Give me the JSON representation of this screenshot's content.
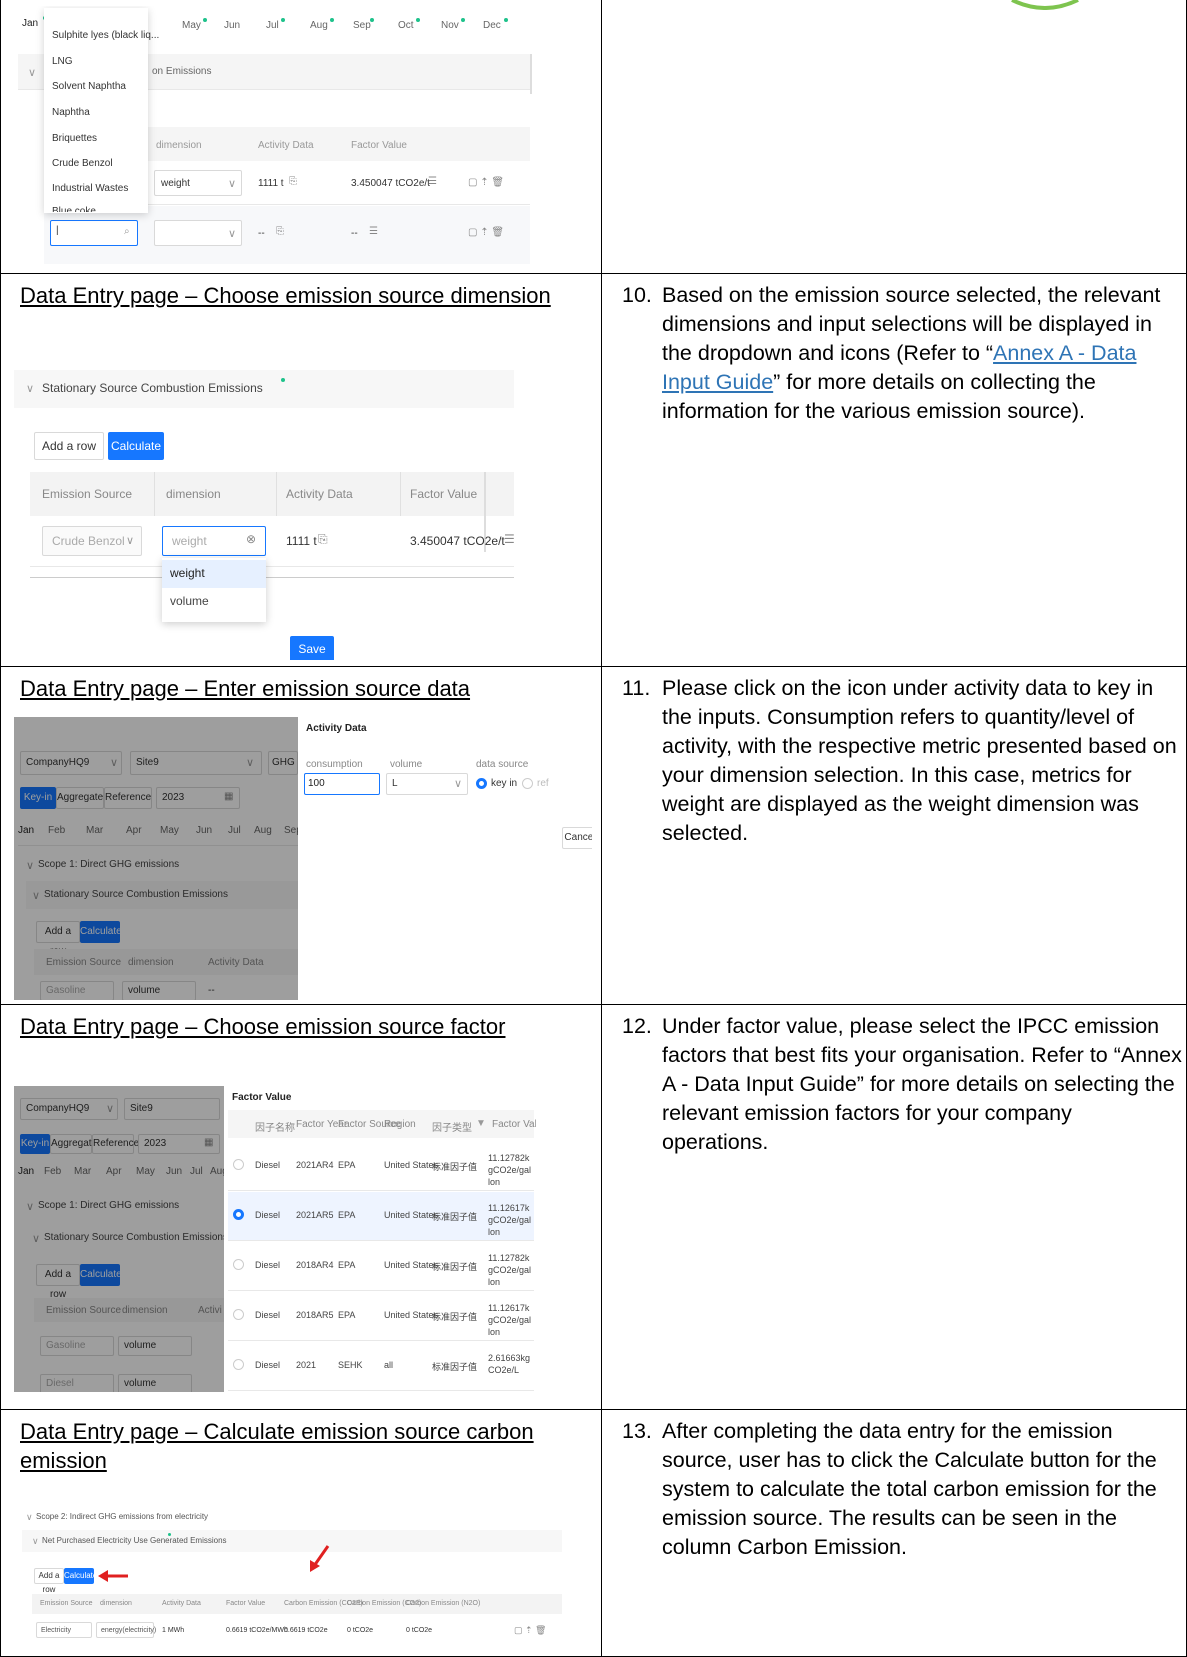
{
  "rows": [
    {
      "caption": "",
      "step_number": "",
      "step_text": ""
    },
    {
      "caption": "Data Entry page – Choose emission source dimension",
      "step_number": "10.",
      "step_text_before": "Based on the emission source selected, the relevant dimensions and input selections will be displayed in the dropdown and icons (Refer to “",
      "step_link": "Annex A - Data Input Guide",
      "step_text_after": "” for more details on collecting the information for the various emission source)."
    },
    {
      "caption": "Data Entry page – Enter emission source data",
      "step_number": "11.",
      "step_text": "Please click on the icon under activity data to key in the inputs. Consumption refers to quantity/level of activity, with the respective metric presented based on your dimension selection. In this case, metrics for weight are displayed as the weight dimension was selected."
    },
    {
      "caption": "Data Entry page – Choose emission source factor",
      "step_number": "12.",
      "step_text": "Under factor value, please select the IPCC emission factors that best fits your organisation.  Refer to “Annex A - Data Input Guide” for more details on selecting the relevant emission factors for your company operations."
    },
    {
      "caption": "Data Entry page – Calculate emission source carbon emission",
      "step_number": "13.",
      "step_text": "After completing the data entry for the emission source, user has to click the Calculate button for the system to calculate the total carbon emission for the emission source. The results can be seen in the column Carbon Emission."
    }
  ],
  "shot1": {
    "months": [
      "Jan",
      "May",
      "Jun",
      "Jul",
      "Aug",
      "Sep",
      "Oct",
      "Nov",
      "Dec"
    ],
    "dropdown_items": [
      "Sulphite lyes (black liq...",
      "LNG",
      "Solvent Naphtha",
      "Naphtha",
      "Briquettes",
      "Crude Benzol",
      "Industrial Wastes",
      "Blue coke"
    ],
    "section_title": "on Emissions",
    "col_dimension": "dimension",
    "col_activity": "Activity Data",
    "col_factor": "Factor Value",
    "row1_dimension": "weight",
    "row1_activity": "1111 t",
    "row1_factor": "3.450047 tCO2e/t",
    "row2_activity": "--",
    "row2_factor": "--",
    "search_placeholder": ""
  },
  "shot2": {
    "section_title": "Stationary Source Combustion Emissions",
    "add_row": "Add a row",
    "calculate": "Calculate",
    "col_source": "Emission Source",
    "col_dimension": "dimension",
    "col_activity": "Activity Data",
    "col_factor": "Factor Value",
    "source_value": "Crude Benzol",
    "dimension_value": "weight",
    "activity_value": "1111 t",
    "factor_value": "3.450047 tCO2e/t",
    "options": [
      "weight",
      "volume"
    ],
    "save": "Save"
  },
  "shot3": {
    "company": "CompanyHQ9",
    "site": "Site9",
    "protocol": "GHG Protoc",
    "tabs": [
      "Key-in",
      "Aggregate",
      "Reference"
    ],
    "year": "2023",
    "months": [
      "Jan",
      "Feb",
      "Mar",
      "Apr",
      "May",
      "Jun",
      "Jul",
      "Aug",
      "Sep"
    ],
    "scope": "Scope 1: Direct GHG emissions",
    "section": "Stationary Source Combustion Emissions",
    "add_row": "Add a row",
    "calculate": "Calculate",
    "col_source": "Emission Source",
    "col_dimension": "dimension",
    "col_activity": "Activity Data",
    "source_value": "Gasoline",
    "dimension_value": "volume",
    "activity_value": "--",
    "panel_title": "Activity Data",
    "lbl_consumption": "consumption",
    "lbl_volume": "volume",
    "lbl_source": "data source",
    "consumption_value": "100",
    "unit_value": "L",
    "radio_keyin": "key in",
    "radio_ref": "ref",
    "cancel": "Cancel"
  },
  "shot4": {
    "company": "CompanyHQ9",
    "site": "Site9",
    "tabs": [
      "Key-in",
      "Aggregate",
      "Reference"
    ],
    "year": "2023",
    "months": [
      "Jan",
      "Feb",
      "Mar",
      "Apr",
      "May",
      "Jun",
      "Jul",
      "Aug"
    ],
    "scope": "Scope 1: Direct GHG emissions",
    "section": "Stationary Source Combustion Emissions",
    "add_row": "Add a row",
    "calculate": "Calculate",
    "col_source": "Emission Source",
    "col_dimension": "dimension",
    "col_activity": "Activi",
    "row1_source": "Gasoline",
    "row1_dimension": "volume",
    "row2_source": "Diesel",
    "row2_dimension": "volume",
    "panel_title": "Factor Value",
    "headers": [
      "因子名称",
      "Factor Year",
      "Factor Source",
      "Region",
      "因子类型",
      "Factor Value"
    ],
    "factors": [
      {
        "name": "Diesel",
        "year": "2021AR4",
        "source": "EPA",
        "region": "United States",
        "type": "标准因子值",
        "value": "11.12782kgCO2e/gallon",
        "selected": false
      },
      {
        "name": "Diesel",
        "year": "2021AR5",
        "source": "EPA",
        "region": "United States",
        "type": "标准因子值",
        "value": "11.12617kgCO2e/gallon",
        "selected": true
      },
      {
        "name": "Diesel",
        "year": "2018AR4",
        "source": "EPA",
        "region": "United States",
        "type": "标准因子值",
        "value": "11.12782kgCO2e/gallon",
        "selected": false
      },
      {
        "name": "Diesel",
        "year": "2018AR5",
        "source": "EPA",
        "region": "United States",
        "type": "标准因子值",
        "value": "11.12617kgCO2e/gallon",
        "selected": false
      },
      {
        "name": "Diesel",
        "year": "2021",
        "source": "SEHK",
        "region": "all",
        "type": "标准因子值",
        "value": "2.61663kgCO2e/L",
        "selected": false
      }
    ]
  },
  "shot5": {
    "scope": "Scope 2: Indirect GHG emissions from electricity",
    "section": "Net Purchased Electricity Use Generated Emissions",
    "add_row": "Add a row",
    "calculate": "Calculate",
    "headers": [
      "Emission Source",
      "dimension",
      "Activity Data",
      "Factor Value",
      "Carbon Emission (CO2E)",
      "Carbon Emission (CO2)",
      "Carbon Emission (N2O)"
    ],
    "row": [
      "Electricity",
      "energy(electricity)",
      "1 MWh",
      "0.6619 tCO2e/MWh",
      "0.6619 tCO2e",
      "0 tCO2e",
      "0 tCO2e"
    ],
    "arrow_color": "#e02020"
  }
}
